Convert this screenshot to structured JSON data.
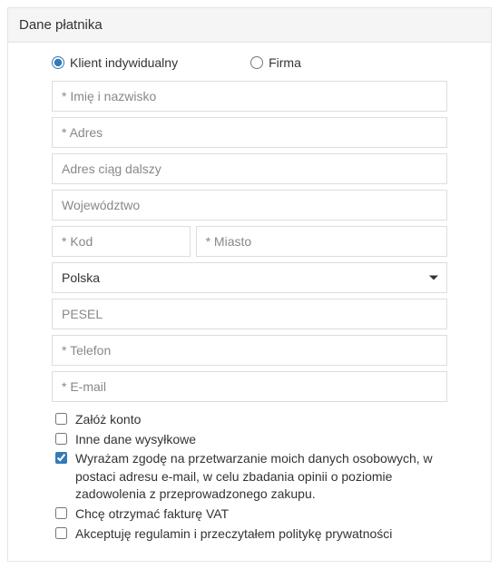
{
  "panel": {
    "title": "Dane płatnika"
  },
  "customerType": {
    "individual": "Klient indywidualny",
    "company": "Firma",
    "selected": "individual"
  },
  "fields": {
    "name": "* Imię i nazwisko",
    "address": "* Adres",
    "address2": "Adres ciąg dalszy",
    "region": "Województwo",
    "zip": "* Kod",
    "city": "* Miasto",
    "country": "Polska",
    "pesel": "PESEL",
    "phone": "* Telefon",
    "email": "* E-mail"
  },
  "checks": {
    "createAccount": {
      "label": "Załóż konto",
      "checked": false
    },
    "otherShipping": {
      "label": "Inne dane wysyłkowe",
      "checked": false
    },
    "consentOpinion": {
      "label": "Wyrażam zgodę na przetwarzanie moich danych osobowych, w postaci adresu e-mail, w celu zbadania opinii o poziomie zadowolenia z przeprowadzonego zakupu.",
      "checked": true
    },
    "vatInvoice": {
      "label": "Chcę otrzymać fakturę VAT",
      "checked": false
    },
    "acceptTerms": {
      "label": "Akceptuję regulamin i przeczytałem politykę prywatności",
      "checked": false
    }
  }
}
